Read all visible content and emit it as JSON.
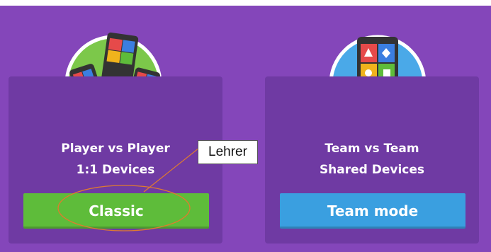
{
  "modes": [
    {
      "line1": "Player vs Player",
      "line2": "1:1 Devices",
      "button": "Classic",
      "color": "#5ebc3a"
    },
    {
      "line1": "Team vs Team",
      "line2": "Shared Devices",
      "button": "Team mode",
      "color": "#3a9fe0"
    }
  ],
  "annotation": {
    "label": "Lehrer",
    "color": "#e07b2e"
  },
  "colors": {
    "background": "#8446ba",
    "card": "#6f3aa3"
  }
}
